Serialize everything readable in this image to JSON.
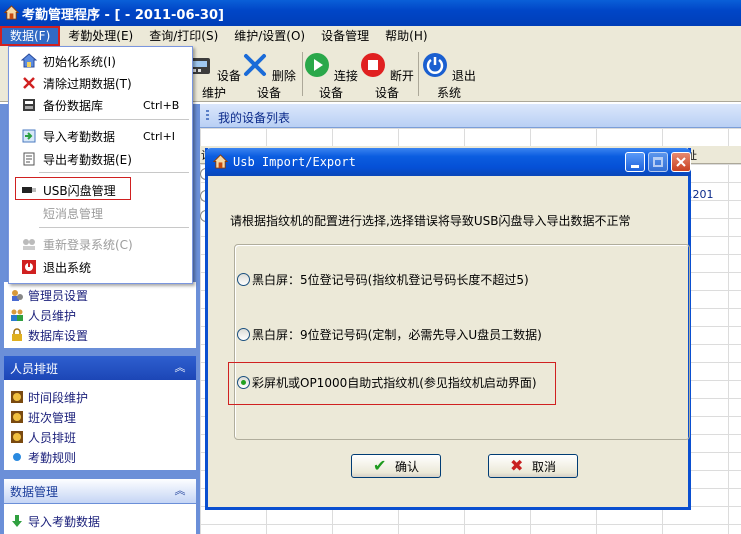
{
  "window": {
    "title": "考勤管理程序 - [ - 2011-06-30]"
  },
  "menubar": {
    "items": [
      "数据(F)",
      "考勤处理(E)",
      "查询/打印(S)",
      "维护/设置(O)",
      "设备管理",
      "帮助(H)"
    ]
  },
  "toolbar": {
    "buttons": [
      "设备维护",
      "删除设备",
      "连接设备",
      "断开设备",
      "退出系统"
    ]
  },
  "data_menu": {
    "items": [
      {
        "label": "初始化系统(I)",
        "shortcut": "",
        "icon": "init-icon",
        "enabled": true
      },
      {
        "label": "清除过期数据(T)",
        "shortcut": "",
        "icon": "delete-x-icon",
        "enabled": true
      },
      {
        "label": "备份数据库",
        "shortcut": "Ctrl+B",
        "icon": "backup-icon",
        "enabled": true
      },
      {
        "label": "导入考勤数据",
        "shortcut": "Ctrl+I",
        "icon": "import-icon",
        "enabled": true
      },
      {
        "label": "导出考勤数据(E)",
        "shortcut": "",
        "icon": "export-icon",
        "enabled": true
      },
      {
        "label": "USB闪盘管理",
        "shortcut": "",
        "icon": "usb-icon",
        "enabled": true
      },
      {
        "label": "短消息管理",
        "shortcut": "",
        "icon": "",
        "enabled": false
      },
      {
        "label": "重新登录系统(C)",
        "shortcut": "",
        "icon": "relogin-icon",
        "enabled": false
      },
      {
        "label": "退出系统",
        "shortcut": "",
        "icon": "exit-icon",
        "enabled": true
      }
    ]
  },
  "left_panel": {
    "top_items": [
      "管理员设置",
      "人员维护",
      "数据库设置"
    ],
    "sections": [
      {
        "title": "人员排班",
        "items": [
          "时间段维护",
          "班次管理",
          "人员排班",
          "考勤规则"
        ]
      },
      {
        "title": "数据管理",
        "items": [
          "导入考勤数据"
        ]
      }
    ]
  },
  "device_list": {
    "label": "我的设备列表",
    "col_first_fragment": "设",
    "col_last_fragment": "址",
    "ip_fragment": "1.201"
  },
  "dialog": {
    "title": "Usb Import/Export",
    "message": "请根据指纹机的配置进行选择,选择错误将导致USB闪盘导入导出数据不正常",
    "options": [
      {
        "label": "黑白屏：5位登记号码(指纹机登记号码长度不超过5)",
        "selected": false
      },
      {
        "label": "黑白屏：9位登记号码(定制，必需先导入U盘员工数据)",
        "selected": false
      },
      {
        "label": "彩屏机或OP1000自助式指纹机(参见指纹机启动界面)",
        "selected": true
      }
    ],
    "ok_label": "确认",
    "cancel_label": "取消"
  },
  "colors": {
    "titlebar_blue": "#0046c7",
    "highlight_red": "#d02020",
    "panel_blue": "#6b8fd8"
  }
}
